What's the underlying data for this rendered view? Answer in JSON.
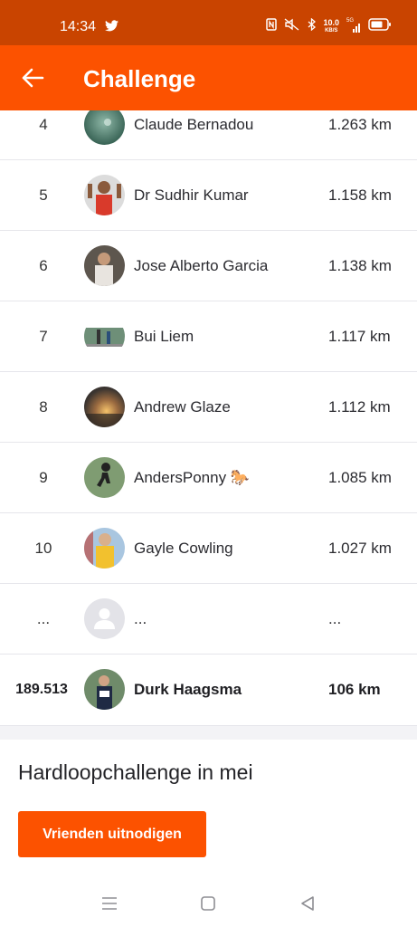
{
  "status_bar": {
    "time": "14:34",
    "net_speed": "10.0",
    "net_unit": "KB/S",
    "signal_label": "5G"
  },
  "header": {
    "title": "Challenge"
  },
  "leaderboard": {
    "rows": [
      {
        "rank": "4",
        "name": "Claude Bernadou",
        "distance": "1.263 km"
      },
      {
        "rank": "5",
        "name": "Dr Sudhir Kumar",
        "distance": "1.158 km"
      },
      {
        "rank": "6",
        "name": "Jose Alberto Garcia",
        "distance": "1.138 km"
      },
      {
        "rank": "7",
        "name": "Bui Liem",
        "distance": "1.117 km"
      },
      {
        "rank": "8",
        "name": "Andrew Glaze",
        "distance": "1.112 km"
      },
      {
        "rank": "9",
        "name": "AndersPonny 🐎",
        "distance": "1.085 km"
      },
      {
        "rank": "10",
        "name": "Gayle Cowling",
        "distance": "1.027 km"
      },
      {
        "rank": "...",
        "name": "...",
        "distance": "..."
      }
    ],
    "current_user": {
      "rank": "189.513",
      "name": "Durk Haagsma",
      "distance": "106 km"
    }
  },
  "challenge_section": {
    "title": "Hardloopchallenge in mei",
    "invite_label": "Vrienden uitnodigen"
  },
  "colors": {
    "brand": "#fc5200",
    "status_bar": "#c94400"
  }
}
